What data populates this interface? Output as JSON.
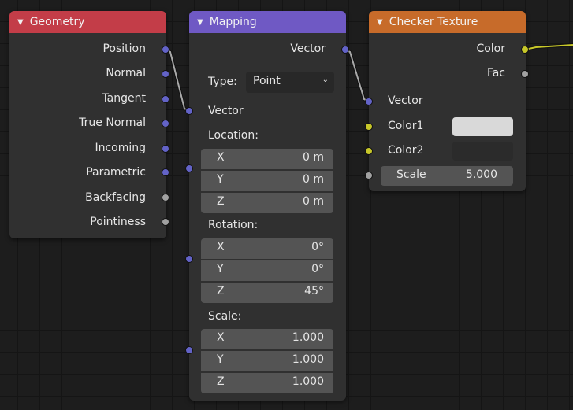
{
  "nodes": {
    "geometry": {
      "title": "Geometry",
      "header_color": "#c33d48",
      "outputs": [
        "Position",
        "Normal",
        "Tangent",
        "True Normal",
        "Incoming",
        "Parametric",
        "Backfacing",
        "Pointiness"
      ]
    },
    "mapping": {
      "title": "Mapping",
      "header_color": "#6f59c4",
      "output": "Vector",
      "type_label": "Type:",
      "type_value": "Point",
      "input_vector": "Vector",
      "location": {
        "label": "Location:",
        "x": "0 m",
        "y": "0 m",
        "z": "0 m"
      },
      "rotation": {
        "label": "Rotation:",
        "x": "0°",
        "y": "0°",
        "z": "45°"
      },
      "scale": {
        "label": "Scale:",
        "x": "1.000",
        "y": "1.000",
        "z": "1.000"
      },
      "axis_labels": {
        "x": "X",
        "y": "Y",
        "z": "Z"
      }
    },
    "checker": {
      "title": "Checker Texture",
      "header_color": "#c76b2a",
      "outputs": [
        "Color",
        "Fac"
      ],
      "inputs": {
        "vector": "Vector",
        "color1": "Color1",
        "color2": "Color2",
        "scale_label": "Scale",
        "scale_value": "5.000"
      },
      "color1_value": "#d9d9d9",
      "color2_value": "#2b2b2b"
    }
  },
  "icons": {
    "collapse": "triangle-down",
    "dropdown": "chevron-down"
  },
  "colors": {
    "vector_socket": "#6363c7",
    "color_socket": "#c7c729",
    "value_socket": "#a1a1a1",
    "link": "#a9a9a9"
  }
}
